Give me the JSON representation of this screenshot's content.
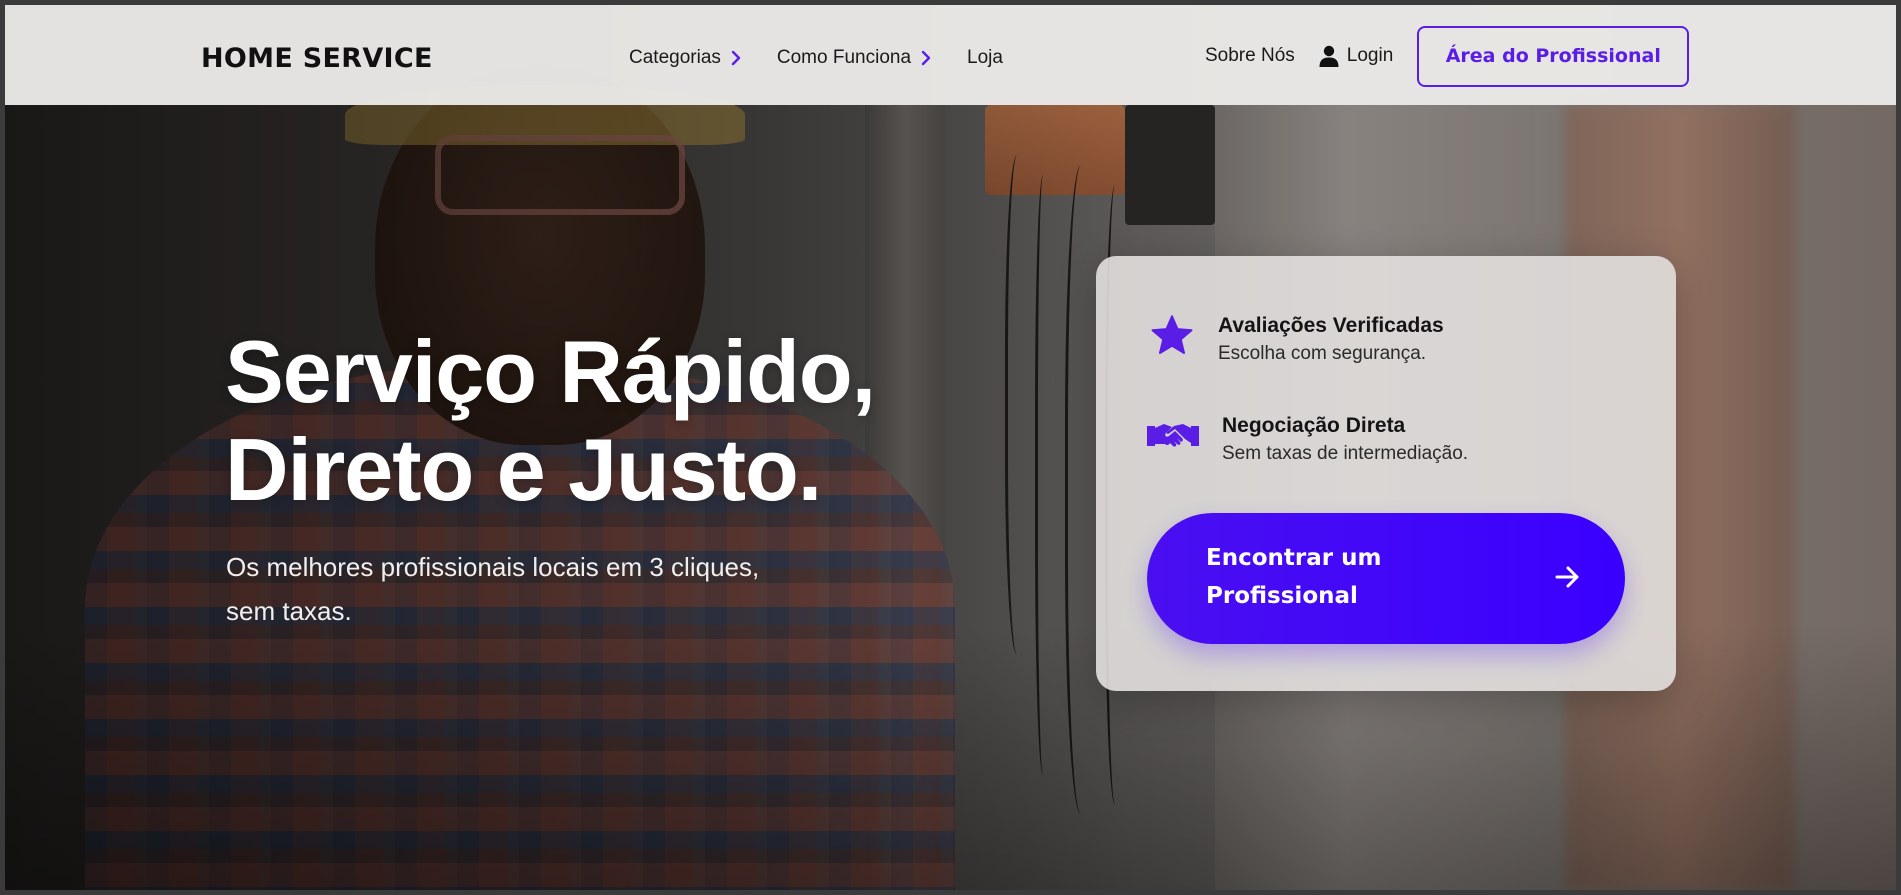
{
  "header": {
    "logo": "HOME SERVICE",
    "nav": [
      {
        "label": "Categorias",
        "has_chevron": true
      },
      {
        "label": "Como Funciona",
        "has_chevron": true
      },
      {
        "label": "Loja",
        "has_chevron": false
      }
    ],
    "about": "Sobre Nós",
    "login": "Login",
    "pro_button": "Área do Profissional"
  },
  "hero": {
    "title_line1": "Serviço Rápido,",
    "title_line2": "Direto e Justo.",
    "subtitle_line1": "Os melhores profissionais locais em 3 cliques,",
    "subtitle_line2": "sem taxas."
  },
  "card": {
    "features": [
      {
        "icon": "star-icon",
        "title": "Avaliações Verificadas",
        "description": "Escolha com segurança."
      },
      {
        "icon": "handshake-icon",
        "title": "Negociação Direta",
        "description": "Sem taxas de intermediação."
      }
    ],
    "cta_line1": "Encontrar um",
    "cta_line2": "Profissional",
    "cta_icon": "arrow-right-icon"
  },
  "colors": {
    "accent": "#5a1de6",
    "cta": "#3a00ff",
    "navbar_bg": "#ebeae8",
    "card_bg": "#e2dfde"
  }
}
